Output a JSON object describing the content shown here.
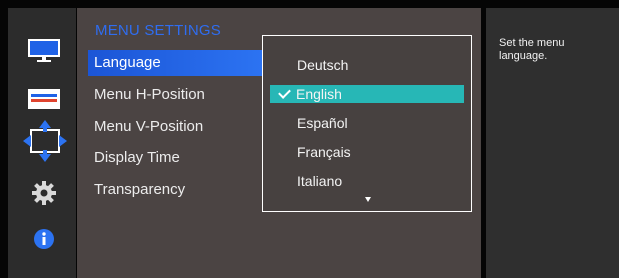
{
  "menu": {
    "title": "MENU SETTINGS",
    "items": [
      {
        "label": "Language"
      },
      {
        "label": "Menu H-Position"
      },
      {
        "label": "Menu V-Position"
      },
      {
        "label": "Display Time"
      },
      {
        "label": "Transparency"
      }
    ],
    "selected_item": "Language"
  },
  "dropdown": {
    "options": [
      {
        "label": "Deutsch"
      },
      {
        "label": "English"
      },
      {
        "label": "Español"
      },
      {
        "label": "Français"
      },
      {
        "label": "Italiano"
      }
    ],
    "selected": "English"
  },
  "help": {
    "text": "Set the menu language."
  },
  "sidebar_icons": [
    "monitor-icon",
    "color-bars-icon",
    "position-arrows-icon",
    "gear-icon",
    "info-icon"
  ],
  "colors": {
    "accent_blue": "#2c73f2",
    "title_blue": "#2f6df0",
    "selection_teal": "#27b7b6",
    "panel": "#4b4443"
  }
}
